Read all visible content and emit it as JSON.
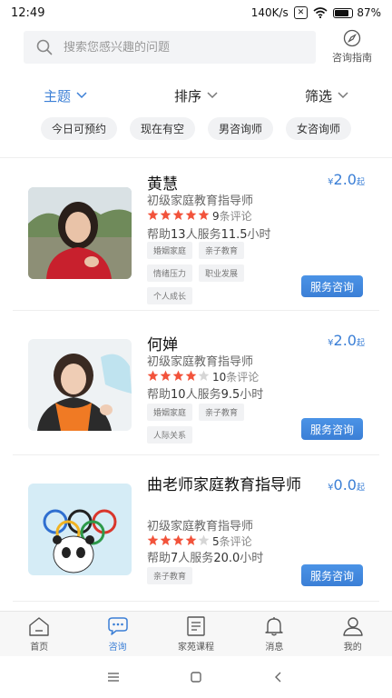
{
  "status_bar": {
    "time": "12:49",
    "network_speed": "140K/s",
    "battery_percent": "87",
    "battery_pct_symbol": "%",
    "battery_level": 0.87
  },
  "search": {
    "placeholder": "搜索您感兴趣的问题",
    "guide_label": "咨询指南"
  },
  "filters": [
    {
      "label": "主题",
      "active": true
    },
    {
      "label": "排序",
      "active": false
    },
    {
      "label": "筛选",
      "active": false
    }
  ],
  "chips": [
    "今日可预约",
    "现在有空",
    "男咨询师",
    "女咨询师"
  ],
  "counselors": [
    {
      "name": "黄慧",
      "price_symbol": "¥",
      "price": "2.0",
      "price_suffix": "起",
      "title": "初级家庭教育指导师",
      "stars": 5,
      "review_count": "9",
      "review_suffix": "条评论",
      "help_prefix": "帮助",
      "helped": "13",
      "help_mid": "人服务",
      "hours": "11.5",
      "help_suffix": "小时",
      "tags": [
        "婚姻家庭",
        "亲子教育",
        "情绪压力",
        "职业发展",
        "个人成长"
      ],
      "button": "服务咨询"
    },
    {
      "name": "何婵",
      "price_symbol": "¥",
      "price": "2.0",
      "price_suffix": "起",
      "title": "初级家庭教育指导师",
      "stars": 4,
      "review_count": "10",
      "review_suffix": "条评论",
      "help_prefix": "帮助",
      "helped": "10",
      "help_mid": "人服务",
      "hours": "9.5",
      "help_suffix": "小时",
      "tags": [
        "婚姻家庭",
        "亲子教育",
        "人际关系"
      ],
      "button": "服务咨询"
    },
    {
      "name": "曲老师家庭教育指导师",
      "price_symbol": "¥",
      "price": "0.0",
      "price_suffix": "起",
      "title": "初级家庭教育指导师",
      "stars": 4,
      "review_count": "5",
      "review_suffix": "条评论",
      "help_prefix": "帮助",
      "helped": "7",
      "help_mid": "人服务",
      "hours": "20.0",
      "help_suffix": "小时",
      "tags": [
        "亲子教育"
      ],
      "button": "服务咨询"
    }
  ],
  "tabs": [
    {
      "label": "首页",
      "icon": "home-icon",
      "active": false
    },
    {
      "label": "咨询",
      "icon": "chat-icon",
      "active": true
    },
    {
      "label": "家苑课程",
      "icon": "book-icon",
      "active": false
    },
    {
      "label": "消息",
      "icon": "bell-icon",
      "active": false
    },
    {
      "label": "我的",
      "icon": "user-icon",
      "active": false
    }
  ],
  "colors": {
    "accent": "#3b7fd6",
    "star": "#f2533b",
    "star_empty": "#d6d6d6"
  }
}
